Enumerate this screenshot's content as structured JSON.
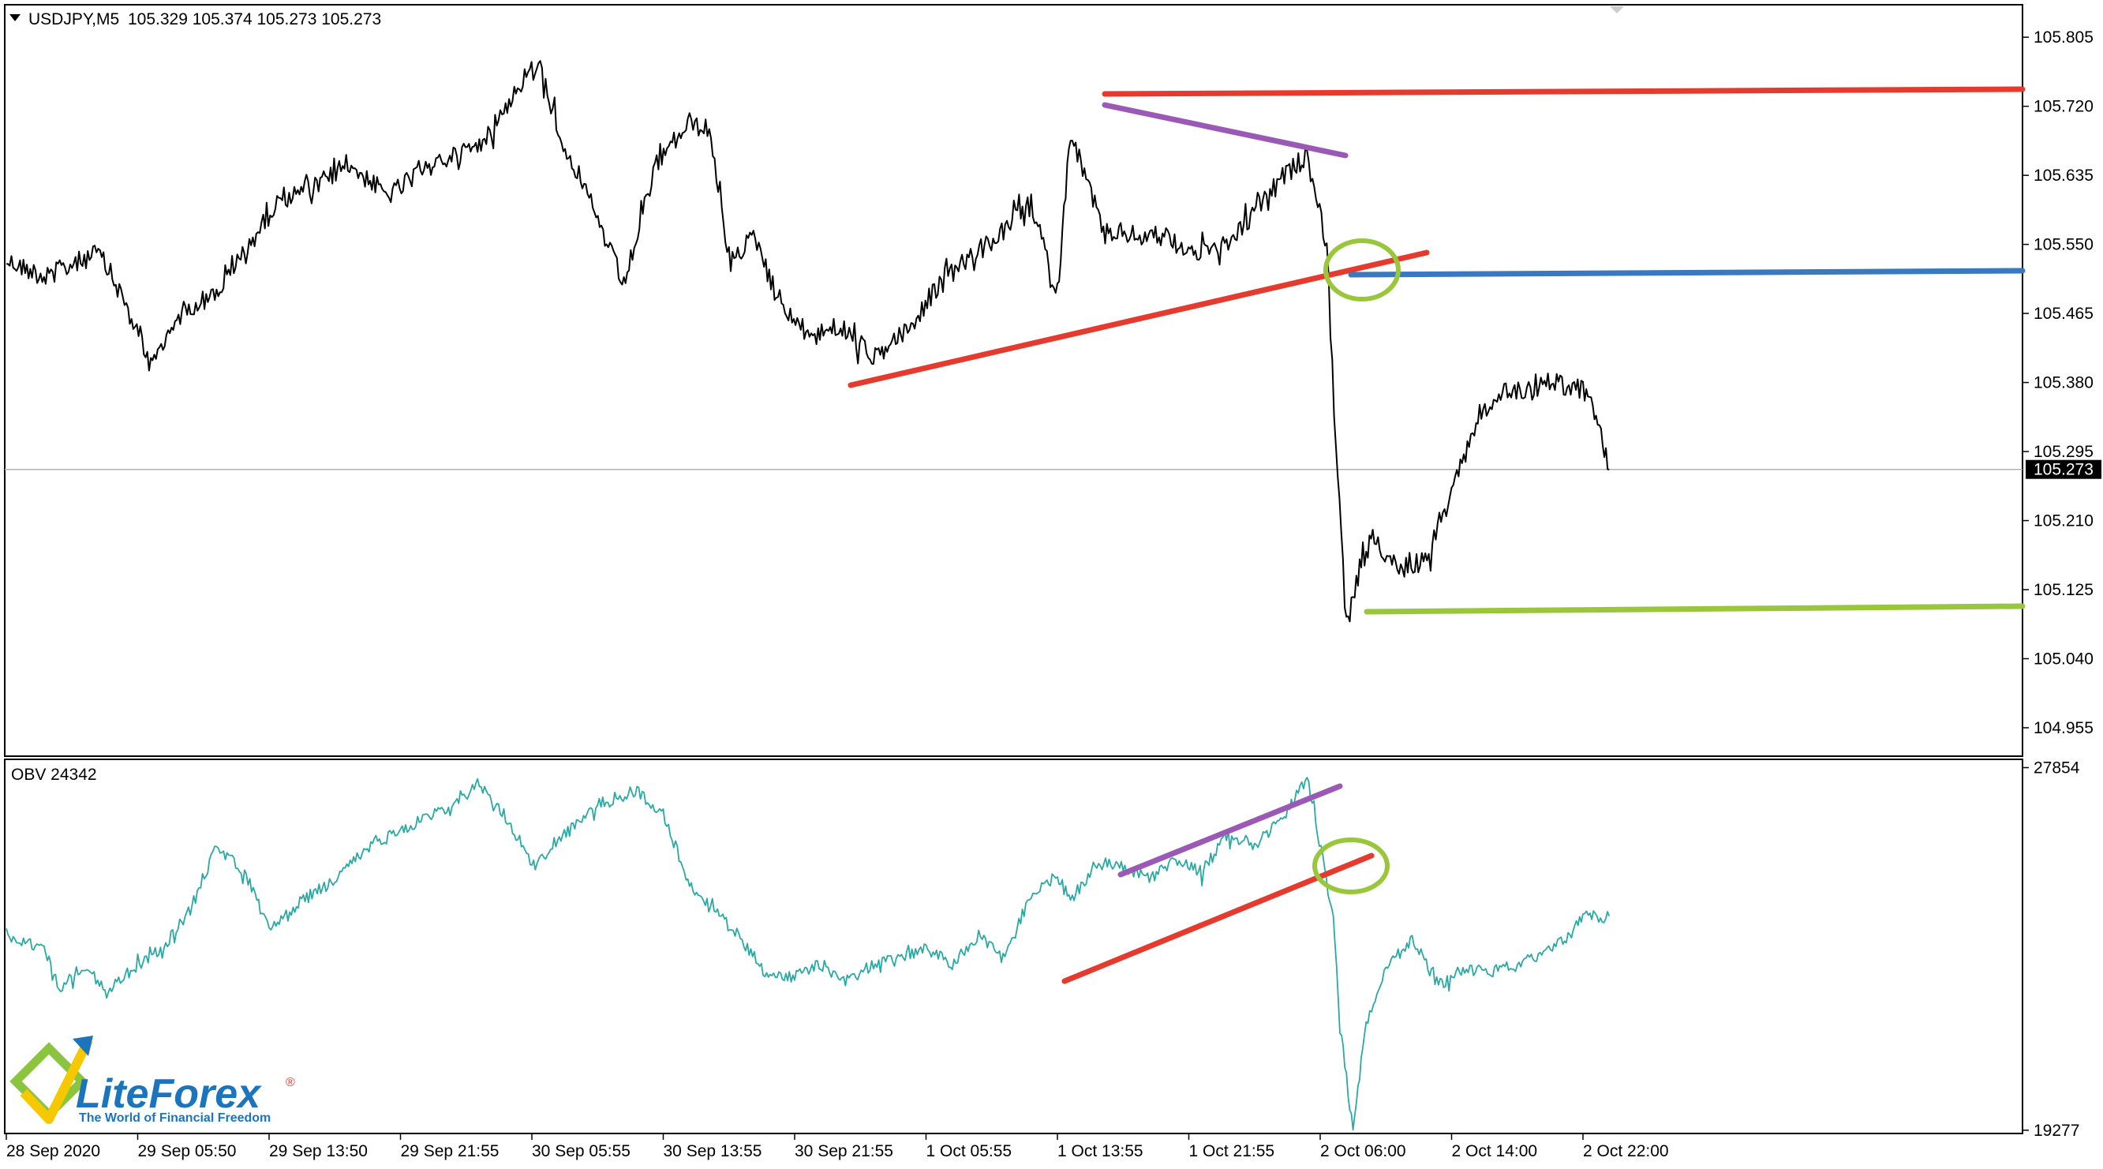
{
  "header": {
    "symbol": "USDJPY,M5",
    "ohlc": "105.329 105.374 105.273 105.273",
    "dropdown_icon": "triangle-down-icon"
  },
  "indicator": {
    "label": "OBV 24342"
  },
  "brand": {
    "name": "LiteForex",
    "registered": "®",
    "tagline": "The World of Financial Freedom",
    "colors": {
      "green": "#8bc53f",
      "yellow": "#f5c800",
      "blue": "#1c75bc"
    }
  },
  "colors": {
    "price_line": "#000000",
    "obv_line": "#2aa9a4",
    "red": "#e53a2e",
    "purple": "#9b59b6",
    "blue": "#3a78c0",
    "green": "#9ac63c",
    "current_price_bg": "#000000"
  },
  "chart_data": [
    {
      "type": "line",
      "title": "USDJPY,M5",
      "ylim": [
        104.92,
        105.845
      ],
      "y_ticks": [
        "105.805",
        "105.720",
        "105.635",
        "105.550",
        "105.465",
        "105.380",
        "105.295",
        "105.210",
        "105.125",
        "105.040",
        "104.955"
      ],
      "current_price": {
        "value": 105.273,
        "label": "105.273"
      },
      "x_ticks": [
        "28 Sep 2020",
        "29 Sep 05:50",
        "29 Sep 13:50",
        "29 Sep 21:55",
        "30 Sep 05:55",
        "30 Sep 13:55",
        "30 Sep 21:55",
        "1 Oct 05:55",
        "1 Oct 13:55",
        "1 Oct 21:55",
        "2 Oct 06:00",
        "2 Oct 14:00",
        "2 Oct 22:00"
      ],
      "series": [
        {
          "x": [
            0,
            0.3,
            0.7,
            0.9,
            1.1,
            1.35,
            1.6,
            1.85,
            2.1,
            2.35,
            2.6,
            2.9,
            3.1,
            3.35,
            3.6,
            3.8,
            4.05,
            4.2,
            4.45,
            4.7,
            4.95,
            5.2,
            5.35,
            5.5,
            5.7,
            5.9,
            6.1,
            6.35,
            6.6,
            6.9,
            7.05,
            7.3,
            7.55,
            7.8,
            8.0,
            8.1,
            8.35,
            8.6,
            8.8,
            9.05,
            9.3,
            9.55,
            9.7,
            9.9,
            10.05,
            10.12,
            10.2,
            10.3,
            10.4,
            10.6,
            10.8,
            11.0,
            11.2,
            11.4,
            11.6,
            11.8,
            12.0,
            12.1,
            12.2
          ],
          "values": [
            105.53,
            105.51,
            105.54,
            105.48,
            105.4,
            105.47,
            105.49,
            105.55,
            105.61,
            105.62,
            105.65,
            105.61,
            105.63,
            105.66,
            105.67,
            105.72,
            105.78,
            105.69,
            105.6,
            105.5,
            105.65,
            105.7,
            105.69,
            105.53,
            105.56,
            105.47,
            105.44,
            105.45,
            105.41,
            105.45,
            105.49,
            105.53,
            105.56,
            105.6,
            105.49,
            105.69,
            105.57,
            105.56,
            105.56,
            105.54,
            105.55,
            105.6,
            105.63,
            105.66,
            105.55,
            105.3,
            105.08,
            105.15,
            105.19,
            105.15,
            105.16,
            105.24,
            105.34,
            105.37,
            105.37,
            105.38,
            105.37,
            105.34,
            105.273
          ]
        }
      ]
    },
    {
      "type": "line",
      "title": "OBV 24342",
      "ylim": [
        19200,
        28050
      ],
      "y_ticks": [
        "27854",
        "19277"
      ],
      "series": [
        {
          "x": [
            0,
            0.3,
            0.4,
            0.6,
            0.75,
            1.0,
            1.2,
            1.4,
            1.6,
            1.8,
            2.0,
            2.3,
            2.5,
            2.8,
            3.0,
            3.3,
            3.6,
            3.8,
            4.0,
            4.3,
            4.5,
            4.8,
            5.0,
            5.2,
            5.4,
            5.6,
            5.8,
            6.0,
            6.2,
            6.4,
            6.6,
            6.8,
            7.0,
            7.2,
            7.4,
            7.6,
            7.8,
            8.0,
            8.1,
            8.3,
            8.5,
            8.7,
            8.9,
            9.1,
            9.3,
            9.5,
            9.7,
            9.9,
            10.1,
            10.15,
            10.25,
            10.35,
            10.5,
            10.7,
            10.9,
            11.1,
            11.3,
            11.5,
            11.7,
            11.9,
            12.0,
            12.2
          ],
          "values": [
            23900,
            23500,
            22600,
            23200,
            22500,
            23200,
            23600,
            24500,
            26000,
            25400,
            24100,
            24800,
            25200,
            26100,
            26400,
            26800,
            27500,
            26700,
            25600,
            26400,
            27000,
            27300,
            26800,
            25100,
            24400,
            23800,
            22900,
            22900,
            23200,
            22800,
            23200,
            23300,
            23600,
            23200,
            23900,
            23300,
            24900,
            25300,
            24700,
            25600,
            25500,
            25200,
            25700,
            25400,
            26300,
            26000,
            26600,
            27600,
            24400,
            21700,
            19300,
            21800,
            23100,
            23800,
            22700,
            23100,
            23000,
            23200,
            23400,
            23900,
            24300,
            24342
          ]
        }
      ]
    }
  ]
}
